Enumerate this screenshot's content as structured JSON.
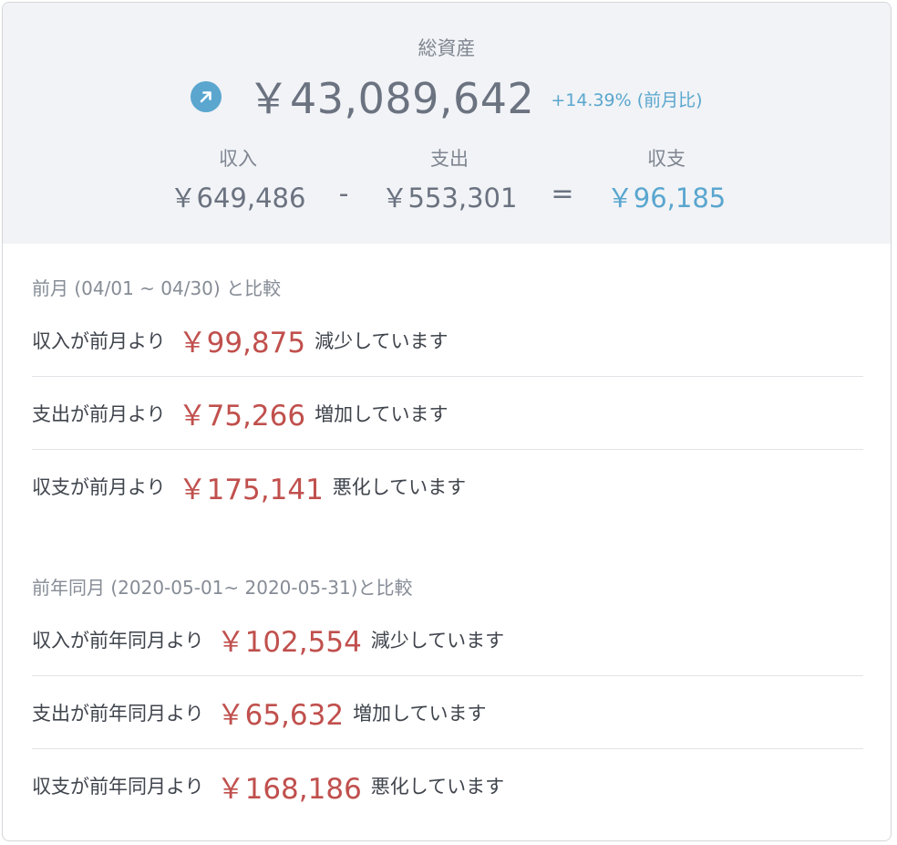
{
  "summary": {
    "total_label": "総資産",
    "total_amount": "￥43,089,642",
    "total_change": "+14.39% (前月比)",
    "trend_icon": "arrow-up-right-icon",
    "income_label": "収入",
    "income_value": "￥649,486",
    "minus_sign": "-",
    "expense_label": "支出",
    "expense_value": "￥553,301",
    "equals_sign": "=",
    "balance_label": "収支",
    "balance_value": "￥96,185"
  },
  "monthly": {
    "title": "前月 (04/01 ~ 04/30) と比較",
    "rows": [
      {
        "prefix": "収入が前月より",
        "amount": "￥99,875",
        "suffix": "減少しています"
      },
      {
        "prefix": "支出が前月より",
        "amount": "￥75,266",
        "suffix": "増加しています"
      },
      {
        "prefix": "収支が前月より",
        "amount": "￥175,141",
        "suffix": "悪化しています"
      }
    ]
  },
  "yearly": {
    "title": "前年同月 (2020-05-01~ 2020-05-31)と比較",
    "rows": [
      {
        "prefix": "収入が前年同月より",
        "amount": "￥102,554",
        "suffix": "減少しています"
      },
      {
        "prefix": "支出が前年同月より",
        "amount": "￥65,632",
        "suffix": "増加しています"
      },
      {
        "prefix": "収支が前年同月より",
        "amount": "￥168,186",
        "suffix": "悪化しています"
      }
    ]
  },
  "colors": {
    "accent_blue": "#5aa6cf",
    "negative_red": "#c0504d",
    "summary_bg": "#f1f3f6"
  }
}
